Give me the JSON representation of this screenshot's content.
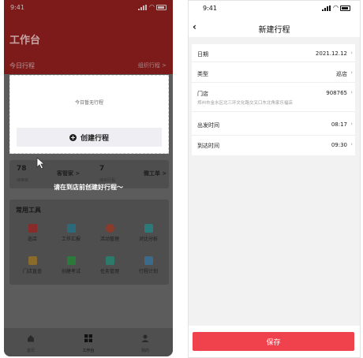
{
  "left_screen": {
    "status_time": "9:41",
    "title": "工作台",
    "today_label": "今日行程",
    "plan_link": "组织行程 >",
    "empty_text": "今日暂无行程",
    "create_button": "创建行程",
    "hint": "请在到店前创建好行程～",
    "stats": [
      {
        "num": "78",
        "label": "待审核",
        "link": "客管家 >"
      },
      {
        "num": "7",
        "label": "待出行程",
        "link": "微工单 >"
      }
    ],
    "tools_title": "常用工具",
    "tools": [
      {
        "label": "巡店",
        "icon": "patrol-icon",
        "color": "#8a2b2b"
      },
      {
        "label": "工作汇报",
        "icon": "report-icon",
        "color": "#2b6a7a"
      },
      {
        "label": "活动管理",
        "icon": "activity-icon",
        "color": "#8a3b2b"
      },
      {
        "label": "对比分析",
        "icon": "analysis-icon",
        "color": "#2b7a7a"
      },
      {
        "label": "门店直查",
        "icon": "store-icon",
        "color": "#8a6b2b"
      },
      {
        "label": "创建考试",
        "icon": "exam-icon",
        "color": "#2b7a3b"
      },
      {
        "label": "任务管理",
        "icon": "task-icon",
        "color": "#2b7a6a"
      },
      {
        "label": "行程计划",
        "icon": "itinerary-icon",
        "color": "#3b6a8a"
      }
    ],
    "tabs": [
      {
        "label": "首页",
        "icon": "home-icon"
      },
      {
        "label": "工作台",
        "icon": "grid-icon"
      },
      {
        "label": "我的",
        "icon": "user-icon"
      }
    ]
  },
  "right_screen": {
    "status_time": "9:41",
    "title": "新建行程",
    "fields": [
      {
        "key": "日期",
        "value": "2021.12.12"
      },
      {
        "key": "类型",
        "value": "巡店"
      },
      {
        "key": "门店",
        "value": "908765",
        "sub": "郑州市金水区北三环文化路交叉口东北角家乐福店"
      },
      {
        "key": "出发时间",
        "value": "08:17"
      },
      {
        "key": "到达时间",
        "value": "09:30"
      }
    ],
    "save_button": "保存"
  },
  "colors": {
    "accent_red": "#f0424c",
    "header_red": "#7d1b1b"
  }
}
